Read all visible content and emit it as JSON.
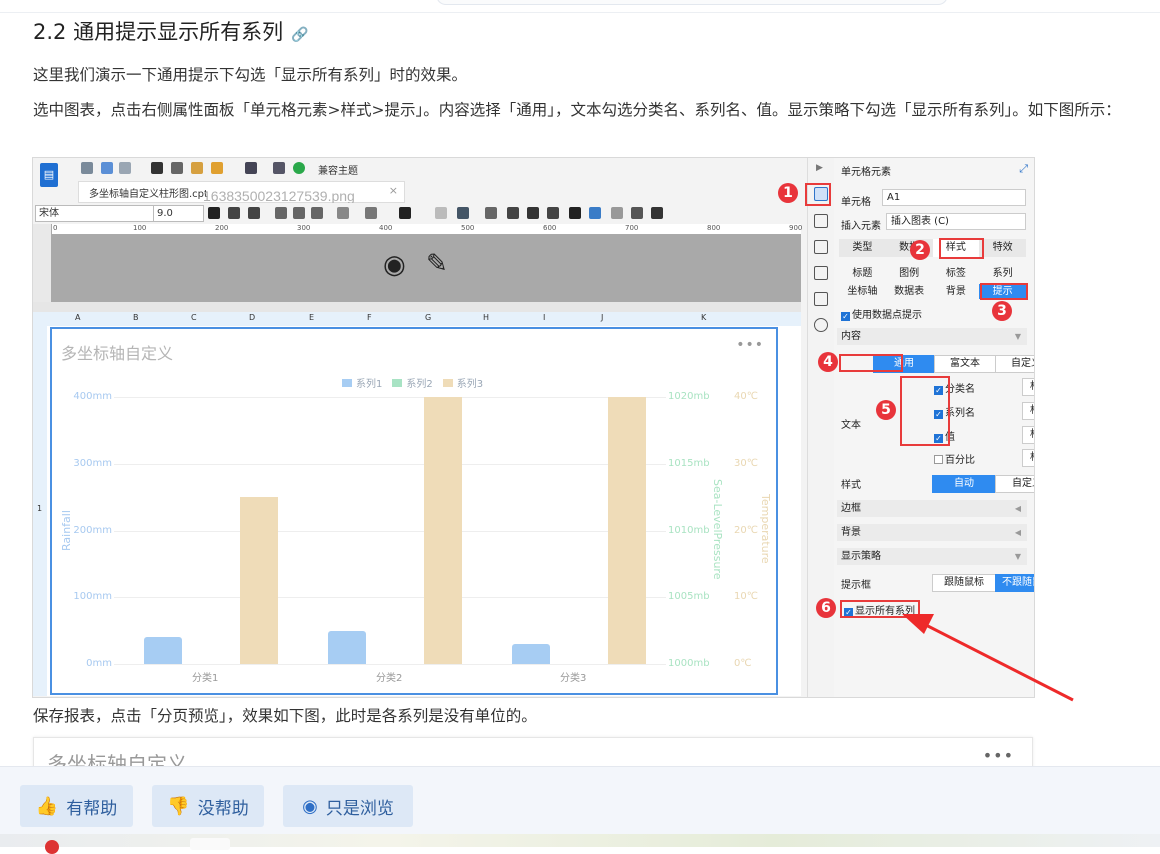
{
  "heading": {
    "text": "2.2 通用提示显示所有系列",
    "anchor_icon": "link-icon"
  },
  "paragraphs": {
    "intro": "这里我们演示一下通用提示下勾选「显示所有系列」时的效果。",
    "steps": "选中图表，点击右侧属性面板「单元格元素>样式>提示」。内容选择「通用」，文本勾选分类名、系列名、值。显示策略下勾选「显示所有系列」。如下图所示：",
    "after": "保存报表，点击「分页预览」，效果如下图，此时是各系列是没有单位的。"
  },
  "screenshot": {
    "toolbar": {
      "compat_theme": "兼容主题",
      "font": "宋体",
      "font_size": "9.0"
    },
    "tab": {
      "label": "多坐标轴自定义柱形图.cpt",
      "close": "×"
    },
    "file_name_overlay": "1638350023127539.png",
    "ruler_ticks": [
      "0",
      "100",
      "200",
      "300",
      "400",
      "500",
      "600",
      "700",
      "800",
      "900"
    ],
    "columns": [
      "A",
      "B",
      "C",
      "D",
      "E",
      "F",
      "G",
      "H",
      "I",
      "J",
      "K"
    ],
    "row": "1",
    "chart": {
      "title": "多坐标轴自定义",
      "more": "•••"
    },
    "panel": {
      "title": "单元格元素",
      "cell_label": "单元格",
      "cell_value": "A1",
      "insert_label": "插入元素",
      "insert_value": "插入图表 (C)",
      "tabs": [
        "类型",
        "数据",
        "样式",
        "特效"
      ],
      "subtabs_row1": [
        "标题",
        "图例",
        "标签",
        "系列"
      ],
      "subtabs_row2": [
        "坐标轴",
        "数据表",
        "背景",
        "提示"
      ],
      "use_tooltip": "使用数据点提示",
      "content_section": "内容",
      "content_modes": [
        "通用",
        "富文本",
        "自定义"
      ],
      "text_label": "文本",
      "text_options": [
        "分类名",
        "系列名",
        "值",
        "百分比"
      ],
      "format_btn": "格式",
      "style_label": "样式",
      "style_modes": [
        "自动",
        "自定义"
      ],
      "border_section": "边框",
      "bg_section": "背景",
      "strategy_section": "显示策略",
      "tooltip_box_label": "提示框",
      "tooltip_box_modes": [
        "跟随鼠标",
        "不跟随鼠标"
      ],
      "show_all_series": "显示所有系列",
      "badges": [
        "1",
        "2",
        "3",
        "4",
        "5",
        "6"
      ]
    }
  },
  "chart_data": {
    "type": "bar",
    "title": "多坐标轴自定义",
    "categories": [
      "分类1",
      "分类2",
      "分类3"
    ],
    "series": [
      {
        "name": "系列1",
        "values": [
          40,
          50,
          30
        ],
        "axis": "left",
        "color": "#a7cdf3"
      },
      {
        "name": "系列2",
        "values": [
          0,
          0,
          0
        ],
        "axis": "right1",
        "color": "#a8e3c4"
      },
      {
        "name": "系列3",
        "values": [
          25,
          40,
          40
        ],
        "axis": "right2",
        "color": "#efdcb8"
      }
    ],
    "y_axes": {
      "left": {
        "label": "Rainfall",
        "ticks": [
          "0mm",
          "100mm",
          "200mm",
          "300mm",
          "400mm"
        ],
        "ylim": [
          0,
          400
        ]
      },
      "right1": {
        "label": "Sea-LevelPressure",
        "ticks": [
          "1000mb",
          "1005mb",
          "1010mb",
          "1015mb",
          "1020mb"
        ],
        "ylim": [
          1000,
          1020
        ]
      },
      "right2": {
        "label": "Temperature",
        "ticks": [
          "0℃",
          "10℃",
          "20℃",
          "30℃",
          "40℃"
        ],
        "ylim": [
          0,
          40
        ]
      }
    },
    "legend_position": "top-center",
    "grid": true
  },
  "preview": {
    "title": "多坐标轴自定义",
    "more": "•••"
  },
  "feedback": {
    "helpful": "有帮助",
    "not_helpful": "没帮助",
    "just_browsing": "只是浏览"
  }
}
